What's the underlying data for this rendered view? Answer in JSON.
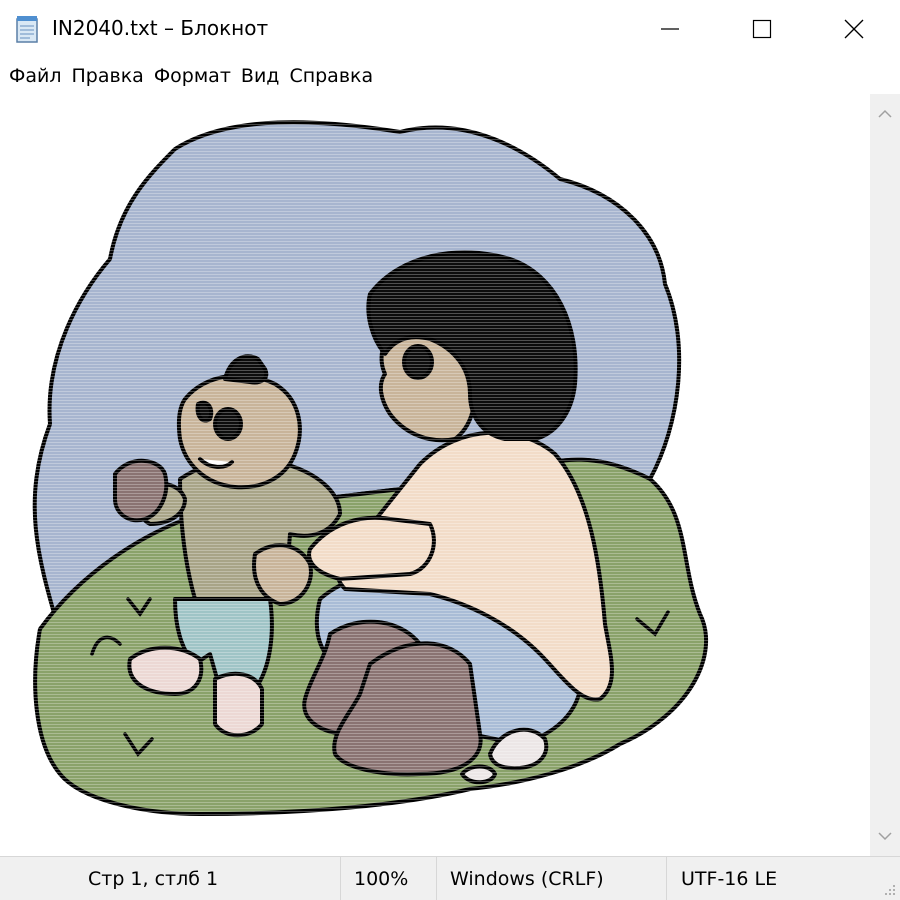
{
  "window": {
    "title": "IN2040.txt – Блокнот"
  },
  "menu": {
    "items": [
      "Файл",
      "Правка",
      "Формат",
      "Вид",
      "Справка"
    ]
  },
  "statusbar": {
    "position": "Стр 1, стлб 1",
    "zoom": "100%",
    "line_ending": "Windows (CRLF)",
    "encoding": "UTF-16 LE"
  },
  "colors": {
    "sky": "#a7b5cf",
    "grass": "#8aa26a",
    "hair": "#0c0c0c",
    "skin": "#c8b49a",
    "shirt_adult": "#f2dcc8",
    "jeans": "#a9bcd6",
    "boots": "#8a7372",
    "baby_top": "#a8a487",
    "baby_pants": "#9fc4c6",
    "socks": "#ecd8d4"
  }
}
